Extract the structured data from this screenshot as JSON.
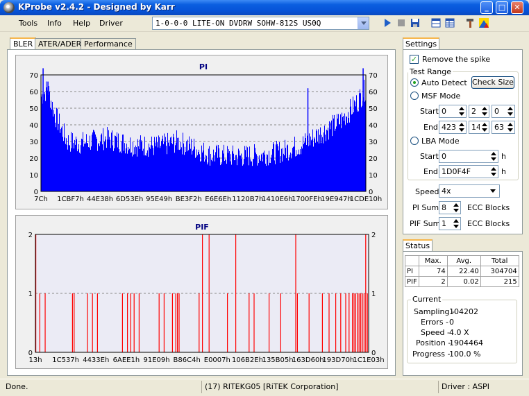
{
  "window": {
    "title": "KProbe v2.4.2 - Designed by Karr",
    "buttons": {
      "minimize": "_",
      "maximize": "□",
      "close": "✕"
    }
  },
  "menu": {
    "items": [
      "Tools",
      "Info",
      "Help",
      "Driver"
    ],
    "device": "1-0-0-0 LITE-ON DVDRW SOHW-812S US0Q"
  },
  "toolbar": {
    "icons": [
      "play-icon",
      "stop-icon",
      "save-icon",
      "layout-icon",
      "table-icon",
      "tools-icon",
      "chart-icon"
    ]
  },
  "tabs": [
    "BLER",
    "ATER/ADER",
    "Performance"
  ],
  "chart_data": [
    {
      "type": "bar",
      "title": "PI",
      "ylim": [
        0,
        70
      ],
      "yticks": [
        0,
        10,
        20,
        30,
        40,
        50,
        60,
        70
      ],
      "tick_labels_x": [
        "7Ch",
        "1CBF7h",
        "44E38h",
        "6D53Eh",
        "95E49h",
        "BE3F2h",
        "E6E6Eh",
        "1120B7h",
        "1410E6h",
        "1700FEh",
        "19E947h",
        "1CDE10h"
      ],
      "series_color": "#0000ff",
      "profile": [
        {
          "pos": 0.0,
          "value": 60
        },
        {
          "pos": 0.02,
          "value": 65
        },
        {
          "pos": 0.04,
          "value": 50
        },
        {
          "pos": 0.08,
          "value": 33
        },
        {
          "pos": 0.12,
          "value": 32
        },
        {
          "pos": 0.2,
          "value": 35
        },
        {
          "pos": 0.28,
          "value": 31
        },
        {
          "pos": 0.36,
          "value": 30
        },
        {
          "pos": 0.42,
          "value": 33
        },
        {
          "pos": 0.46,
          "value": 30
        },
        {
          "pos": 0.52,
          "value": 25
        },
        {
          "pos": 0.6,
          "value": 24
        },
        {
          "pos": 0.68,
          "value": 25
        },
        {
          "pos": 0.74,
          "value": 27
        },
        {
          "pos": 0.8,
          "value": 31
        },
        {
          "pos": 0.86,
          "value": 38
        },
        {
          "pos": 0.92,
          "value": 45
        },
        {
          "pos": 0.97,
          "value": 56
        },
        {
          "pos": 1.0,
          "value": 65
        }
      ],
      "spikes": [
        {
          "pos": 0.005,
          "value": 74
        },
        {
          "pos": 0.02,
          "value": 66
        },
        {
          "pos": 0.82,
          "value": 62
        },
        {
          "pos": 0.99,
          "value": 74
        }
      ]
    },
    {
      "type": "bar",
      "title": "PIF",
      "ylim": [
        0,
        2
      ],
      "yticks": [
        0,
        1,
        2
      ],
      "tick_labels_x": [
        "13h",
        "1C537h",
        "4433Eh",
        "6AEE1h",
        "91E09h",
        "B86C4h",
        "E0007h",
        "106B2Eh",
        "135B05h",
        "163D60h",
        "193D70h",
        "1C1E03h"
      ],
      "series_color": "#ff0000",
      "events": [
        {
          "pos": 0.0,
          "value": 2
        },
        {
          "pos": 0.012,
          "value": 1
        },
        {
          "pos": 0.028,
          "value": 1
        },
        {
          "pos": 0.11,
          "value": 1
        },
        {
          "pos": 0.115,
          "value": 1
        },
        {
          "pos": 0.155,
          "value": 1
        },
        {
          "pos": 0.17,
          "value": 1
        },
        {
          "pos": 0.185,
          "value": 1
        },
        {
          "pos": 0.26,
          "value": 1
        },
        {
          "pos": 0.275,
          "value": 1
        },
        {
          "pos": 0.285,
          "value": 1
        },
        {
          "pos": 0.295,
          "value": 1
        },
        {
          "pos": 0.31,
          "value": 1
        },
        {
          "pos": 0.37,
          "value": 1
        },
        {
          "pos": 0.385,
          "value": 1
        },
        {
          "pos": 0.41,
          "value": 1
        },
        {
          "pos": 0.42,
          "value": 1
        },
        {
          "pos": 0.425,
          "value": 1
        },
        {
          "pos": 0.43,
          "value": 1
        },
        {
          "pos": 0.49,
          "value": 1
        },
        {
          "pos": 0.5,
          "value": 2
        },
        {
          "pos": 0.52,
          "value": 2
        },
        {
          "pos": 0.575,
          "value": 1
        },
        {
          "pos": 0.6,
          "value": 2
        },
        {
          "pos": 0.64,
          "value": 1
        },
        {
          "pos": 0.655,
          "value": 1
        },
        {
          "pos": 0.7,
          "value": 1
        },
        {
          "pos": 0.735,
          "value": 1
        },
        {
          "pos": 0.78,
          "value": 2
        },
        {
          "pos": 0.785,
          "value": 1
        },
        {
          "pos": 0.82,
          "value": 1
        },
        {
          "pos": 0.86,
          "value": 1
        },
        {
          "pos": 0.88,
          "value": 1
        },
        {
          "pos": 0.9,
          "value": 1
        },
        {
          "pos": 0.915,
          "value": 1
        },
        {
          "pos": 0.93,
          "value": 1
        },
        {
          "pos": 0.94,
          "value": 1
        },
        {
          "pos": 0.95,
          "value": 1
        },
        {
          "pos": 0.955,
          "value": 1
        },
        {
          "pos": 0.96,
          "value": 1
        },
        {
          "pos": 0.965,
          "value": 1
        },
        {
          "pos": 0.97,
          "value": 1
        },
        {
          "pos": 0.975,
          "value": 1
        },
        {
          "pos": 0.98,
          "value": 1
        },
        {
          "pos": 0.985,
          "value": 1
        },
        {
          "pos": 0.99,
          "value": 2
        },
        {
          "pos": 0.995,
          "value": 1
        }
      ]
    }
  ],
  "settings": {
    "tab": "Settings",
    "remove_spike": "Remove the spike",
    "test_range": "Test Range",
    "auto_detect": "Auto Detect",
    "check_size": "Check Size",
    "msf_mode": "MSF Mode",
    "start": "Start",
    "end": "End",
    "msf_start": [
      "0",
      "2",
      "0"
    ],
    "msf_end": [
      "423",
      "14",
      "63"
    ],
    "lba_mode": "LBA Mode",
    "lba_start": "0",
    "lba_end": "1D0F4F",
    "h": "h",
    "speed_label": "Speed",
    "speed_value": "4x",
    "pi_sum_label": "PI Sum",
    "pi_sum_value": "8",
    "pif_sum_label": "PIF Sum",
    "pif_sum_value": "1",
    "ecc_blocks": "ECC Blocks"
  },
  "status": {
    "tab": "Status",
    "headers": [
      "",
      "Max.",
      "Avg.",
      "Total"
    ],
    "rows": [
      [
        "PI",
        "74",
        "22.40",
        "304704"
      ],
      [
        "PIF",
        "2",
        "0.02",
        "215"
      ]
    ],
    "current": "Current",
    "sampling_label": "Sampling -",
    "sampling": "104202",
    "errors_label": "Errors -",
    "errors": "0",
    "speed_label": "Speed -",
    "speed": "4.0  X",
    "position_label": "Position -",
    "position": "1904464",
    "progress_label": "Progress -",
    "progress": "100.0 %"
  },
  "statusbar": {
    "left": "Done.",
    "middle": "(17) RITEKG05 [RiTEK Corporation]",
    "right": "Driver : ASPI"
  }
}
